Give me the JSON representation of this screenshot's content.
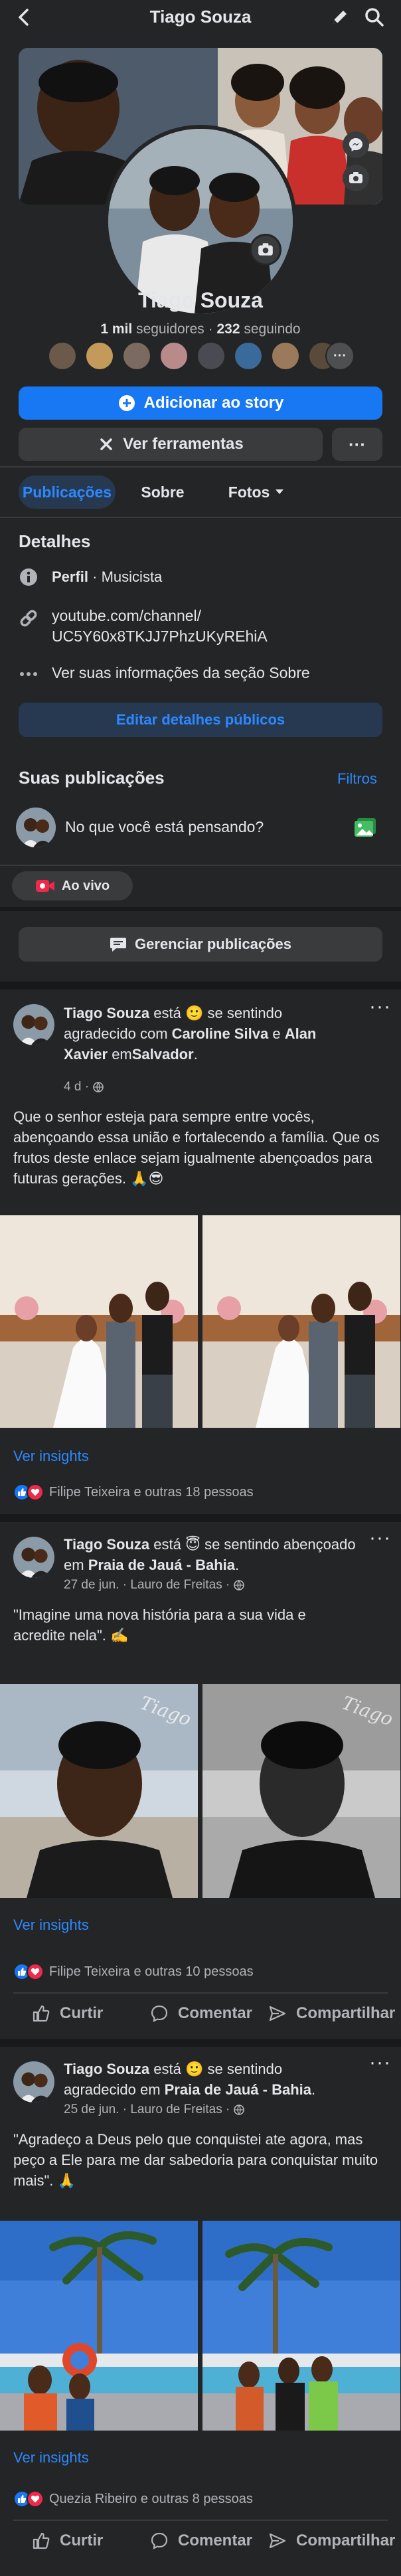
{
  "header": {
    "title": "Tiago Souza",
    "back_icon": "back-arrow-icon",
    "edit_icon": "pencil-icon",
    "search_icon": "search-icon"
  },
  "profile": {
    "name": "Tiago Souza",
    "followers_count": "1 mil",
    "followers_label": "seguidores",
    "separator": "·",
    "following_count": "232",
    "following_label": "seguindo",
    "add_story_label": "Adicionar ao story",
    "tools_label": "Ver ferramentas",
    "more_label": "···"
  },
  "tabs": {
    "posts": "Publicações",
    "about": "Sobre",
    "photos": "Fotos"
  },
  "details": {
    "title": "Detalhes",
    "profile_prefix": "Perfil",
    "profile_dot": "·",
    "profile_value": "Musicista",
    "link_line1": "youtube.com/channel/",
    "link_line2": "UC5Y60x8TKJJ7PhzUKyREhiA",
    "see_about": "Ver suas informações da seção Sobre",
    "edit_button": "Editar detalhes públicos"
  },
  "composer": {
    "title": "Suas publicações",
    "filters": "Filtros",
    "placeholder": "No que você está pensando?",
    "live_label": "Ao vivo",
    "manage_label": "Gerenciar publicações"
  },
  "posts": [
    {
      "author": "Tiago Souza",
      "is_word": "está",
      "feeling": "se sentindo agradecido com",
      "with1": "Caroline Silva",
      "and": "e",
      "with2": "Alan Xavier",
      "in_word": "em",
      "place": "Salvador",
      "period": ".",
      "time": "4 d ·",
      "body": "Que o senhor esteja para sempre entre vocês, abençoando essa união e fortalecendo a família. Que os frutos deste enlace sejam igualmente abençoados para futuras gerações. 🙏😎",
      "insights": "Ver insights",
      "reactions": "Filipe Teixeira e outras 18 pessoas"
    },
    {
      "author": "Tiago Souza",
      "is_word": "está",
      "feeling": "se sentindo abençoado em",
      "place": "Praia de Jauá - Bahia",
      "period": ".",
      "time": "27 de jun. · Lauro de Freitas ·",
      "body": "\"Imagine uma nova história para a sua vida e acredite nela\". ✍️",
      "insights": "Ver insights",
      "reactions": "Filipe Teixeira e outras 10 pessoas",
      "watermark": "Tiago"
    },
    {
      "author": "Tiago Souza",
      "is_word": "está",
      "feeling": "se sentindo agradecido em",
      "place": "Praia de Jauá - Bahia",
      "period": ".",
      "time": "25 de jun. · Lauro de Freitas ·",
      "body": "\"Agradeço a Deus pelo que conquistei ate agora, mas peço a Ele para me dar sabedoria para conquistar muito mais\". 🙏",
      "insights": "Ver insights",
      "reactions": "Quezia Ribeiro e outras 8 pessoas"
    }
  ],
  "actions": {
    "like": "Curtir",
    "comment": "Comentar",
    "share": "Compartilhar"
  },
  "colors": {
    "background": "#18191a",
    "card": "#242526",
    "accent_blue": "#2d88ff",
    "button_blue": "#1877f2",
    "secondary_button": "#3a3b3c",
    "text": "#e4e6eb",
    "muted": "#b0b3b8",
    "filters_link": "#2d88ff",
    "live_red": "#f02849",
    "gallery_green": "#45bd62"
  }
}
